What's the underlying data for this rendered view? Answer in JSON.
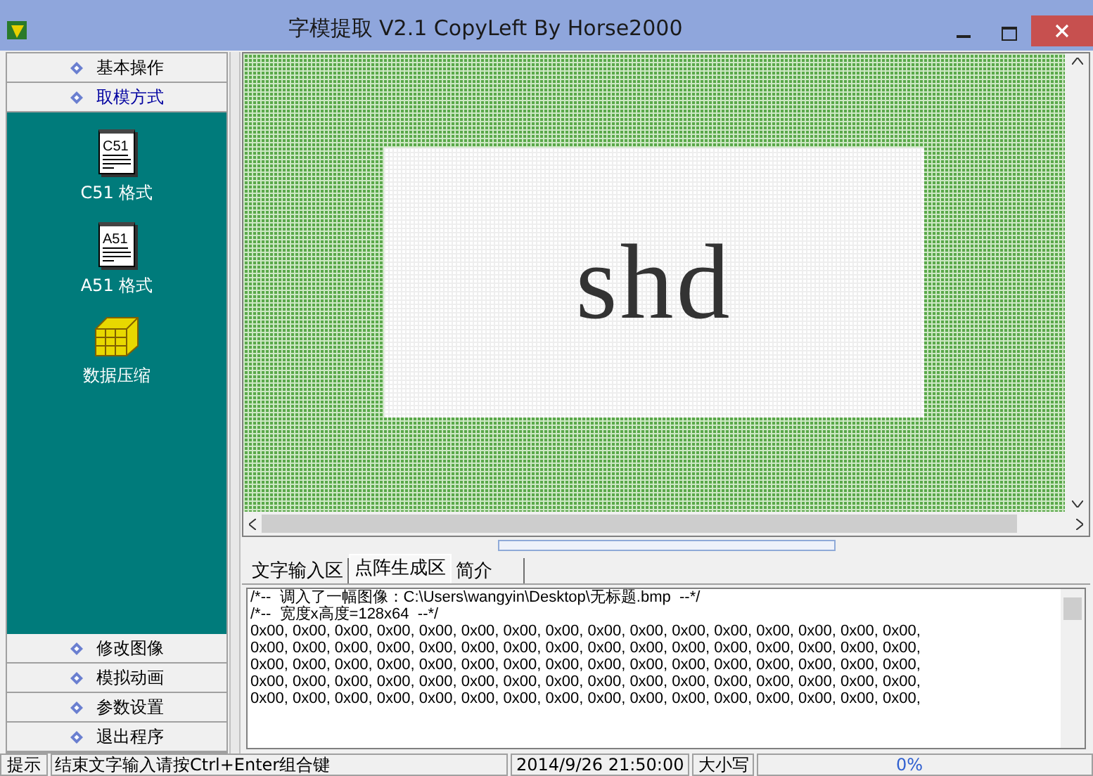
{
  "window": {
    "title": "字模提取 V2.1  CopyLeft By Horse2000"
  },
  "sidebar": {
    "top_buttons": [
      {
        "label": "基本操作",
        "selected": false
      },
      {
        "label": "取模方式",
        "selected": true
      }
    ],
    "items": [
      {
        "kind": "doc",
        "icon_text": "C51",
        "label": "C51 格式"
      },
      {
        "kind": "doc",
        "icon_text": "A51",
        "label": "A51 格式"
      },
      {
        "kind": "cube",
        "label": "数据压缩"
      }
    ],
    "bottom_buttons": [
      {
        "label": "修改图像"
      },
      {
        "label": "模拟动画"
      },
      {
        "label": "参数设置"
      },
      {
        "label": "退出程序"
      }
    ]
  },
  "canvas": {
    "preview_text": "shd"
  },
  "tabs": [
    {
      "label": "文字输入区",
      "selected": false
    },
    {
      "label": "点阵生成区",
      "selected": true
    },
    {
      "label": "简介",
      "selected": false
    }
  ],
  "output": {
    "lines": [
      "/*--  调入了一幅图像：C:\\Users\\wangyin\\Desktop\\无标题.bmp  --*/",
      "/*--  宽度x高度=128x64  --*/",
      "0x00, 0x00, 0x00, 0x00, 0x00, 0x00, 0x00, 0x00, 0x00, 0x00, 0x00, 0x00, 0x00, 0x00, 0x00, 0x00,",
      "0x00, 0x00, 0x00, 0x00, 0x00, 0x00, 0x00, 0x00, 0x00, 0x00, 0x00, 0x00, 0x00, 0x00, 0x00, 0x00,",
      "0x00, 0x00, 0x00, 0x00, 0x00, 0x00, 0x00, 0x00, 0x00, 0x00, 0x00, 0x00, 0x00, 0x00, 0x00, 0x00,",
      "0x00, 0x00, 0x00, 0x00, 0x00, 0x00, 0x00, 0x00, 0x00, 0x00, 0x00, 0x00, 0x00, 0x00, 0x00, 0x00,",
      "0x00, 0x00, 0x00, 0x00, 0x00, 0x00, 0x00, 0x00, 0x00, 0x00, 0x00, 0x00, 0x00, 0x00, 0x00, 0x00,"
    ]
  },
  "status_bar": {
    "label": "提示",
    "message": "结束文字输入请按Ctrl+Enter组合键",
    "datetime": "2014/9/26 21:50:00",
    "caps": "大小写",
    "progress": "0%",
    "level": 0
  }
}
